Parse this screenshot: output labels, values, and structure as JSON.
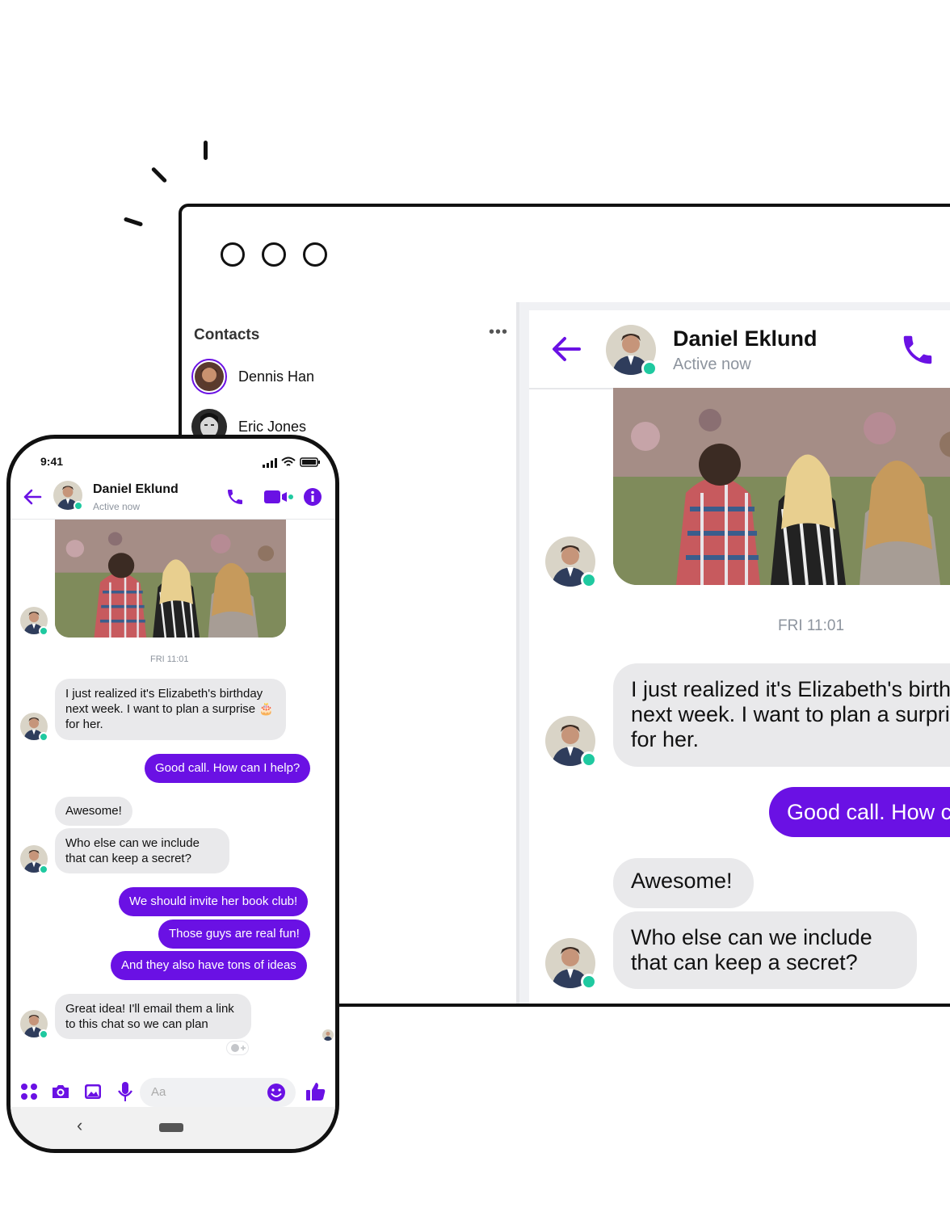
{
  "desktop": {
    "contacts_title": "Contacts",
    "contacts_more": "•••",
    "contacts": [
      {
        "name": "Dennis Han"
      },
      {
        "name": "Eric Jones"
      }
    ],
    "chat": {
      "name": "Daniel Eklund",
      "status": "Active now",
      "timestamp": "FRI 11:01",
      "messages": {
        "m1": "I just realized it's Elizabeth's birthday next week. I want to plan a surprise 🎂 for her.",
        "m2": "Good call. How can I help?",
        "m3": "Awesome!",
        "m4": "Who else can we include that can keep a secret?"
      }
    }
  },
  "phone": {
    "status_time": "9:41",
    "chat": {
      "name": "Daniel Eklund",
      "status": "Active now",
      "timestamp": "FRI 11:01",
      "messages": {
        "m1": "I just realized it's Elizabeth's birthday next week. I want to plan a surprise 🎂 for her.",
        "m2": "Good call. How can I help?",
        "m3": "Awesome!",
        "m4": "Who else can we include that can keep a secret?",
        "m5": "We should invite her book club!",
        "m6": "Those guys are real fun!",
        "m7": "And they also have tons of ideas",
        "m8": "Great idea! I'll email them a link to this chat so we can plan"
      }
    },
    "composer_placeholder": "Aa",
    "nav_back": "‹"
  },
  "colors": {
    "accent": "#6a11e4",
    "online": "#1fc9a0",
    "incoming_bubble": "#e9e9eb",
    "muted_text": "#8d949e"
  },
  "icons": [
    "back-arrow-icon",
    "phone-icon",
    "video-icon",
    "info-icon",
    "apps-icon",
    "camera-icon",
    "gallery-icon",
    "microphone-icon",
    "emoji-icon",
    "thumbs-up-icon",
    "signal-icon",
    "wifi-icon",
    "battery-icon",
    "add-reaction-icon"
  ]
}
